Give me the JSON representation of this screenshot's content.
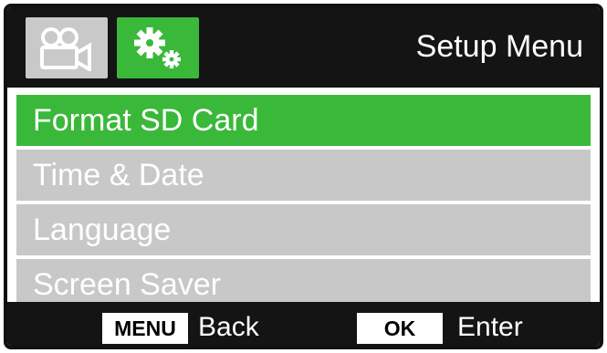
{
  "header": {
    "title": "Setup Menu",
    "tabs": [
      {
        "icon": "video-camera-icon",
        "active": false
      },
      {
        "icon": "gears-icon",
        "active": true
      }
    ]
  },
  "menu": {
    "items": [
      {
        "label": "Format SD Card",
        "selected": true
      },
      {
        "label": "Time & Date",
        "selected": false
      },
      {
        "label": "Language",
        "selected": false
      },
      {
        "label": "Screen Saver",
        "selected": false
      }
    ]
  },
  "footer": {
    "menu_key": "MENU",
    "menu_action": "Back",
    "ok_key": "OK",
    "ok_action": "Enter"
  },
  "colors": {
    "accent": "#3ab83a",
    "item_bg": "#c8c8c8",
    "bar_bg": "#141414",
    "text": "#ffffff"
  }
}
